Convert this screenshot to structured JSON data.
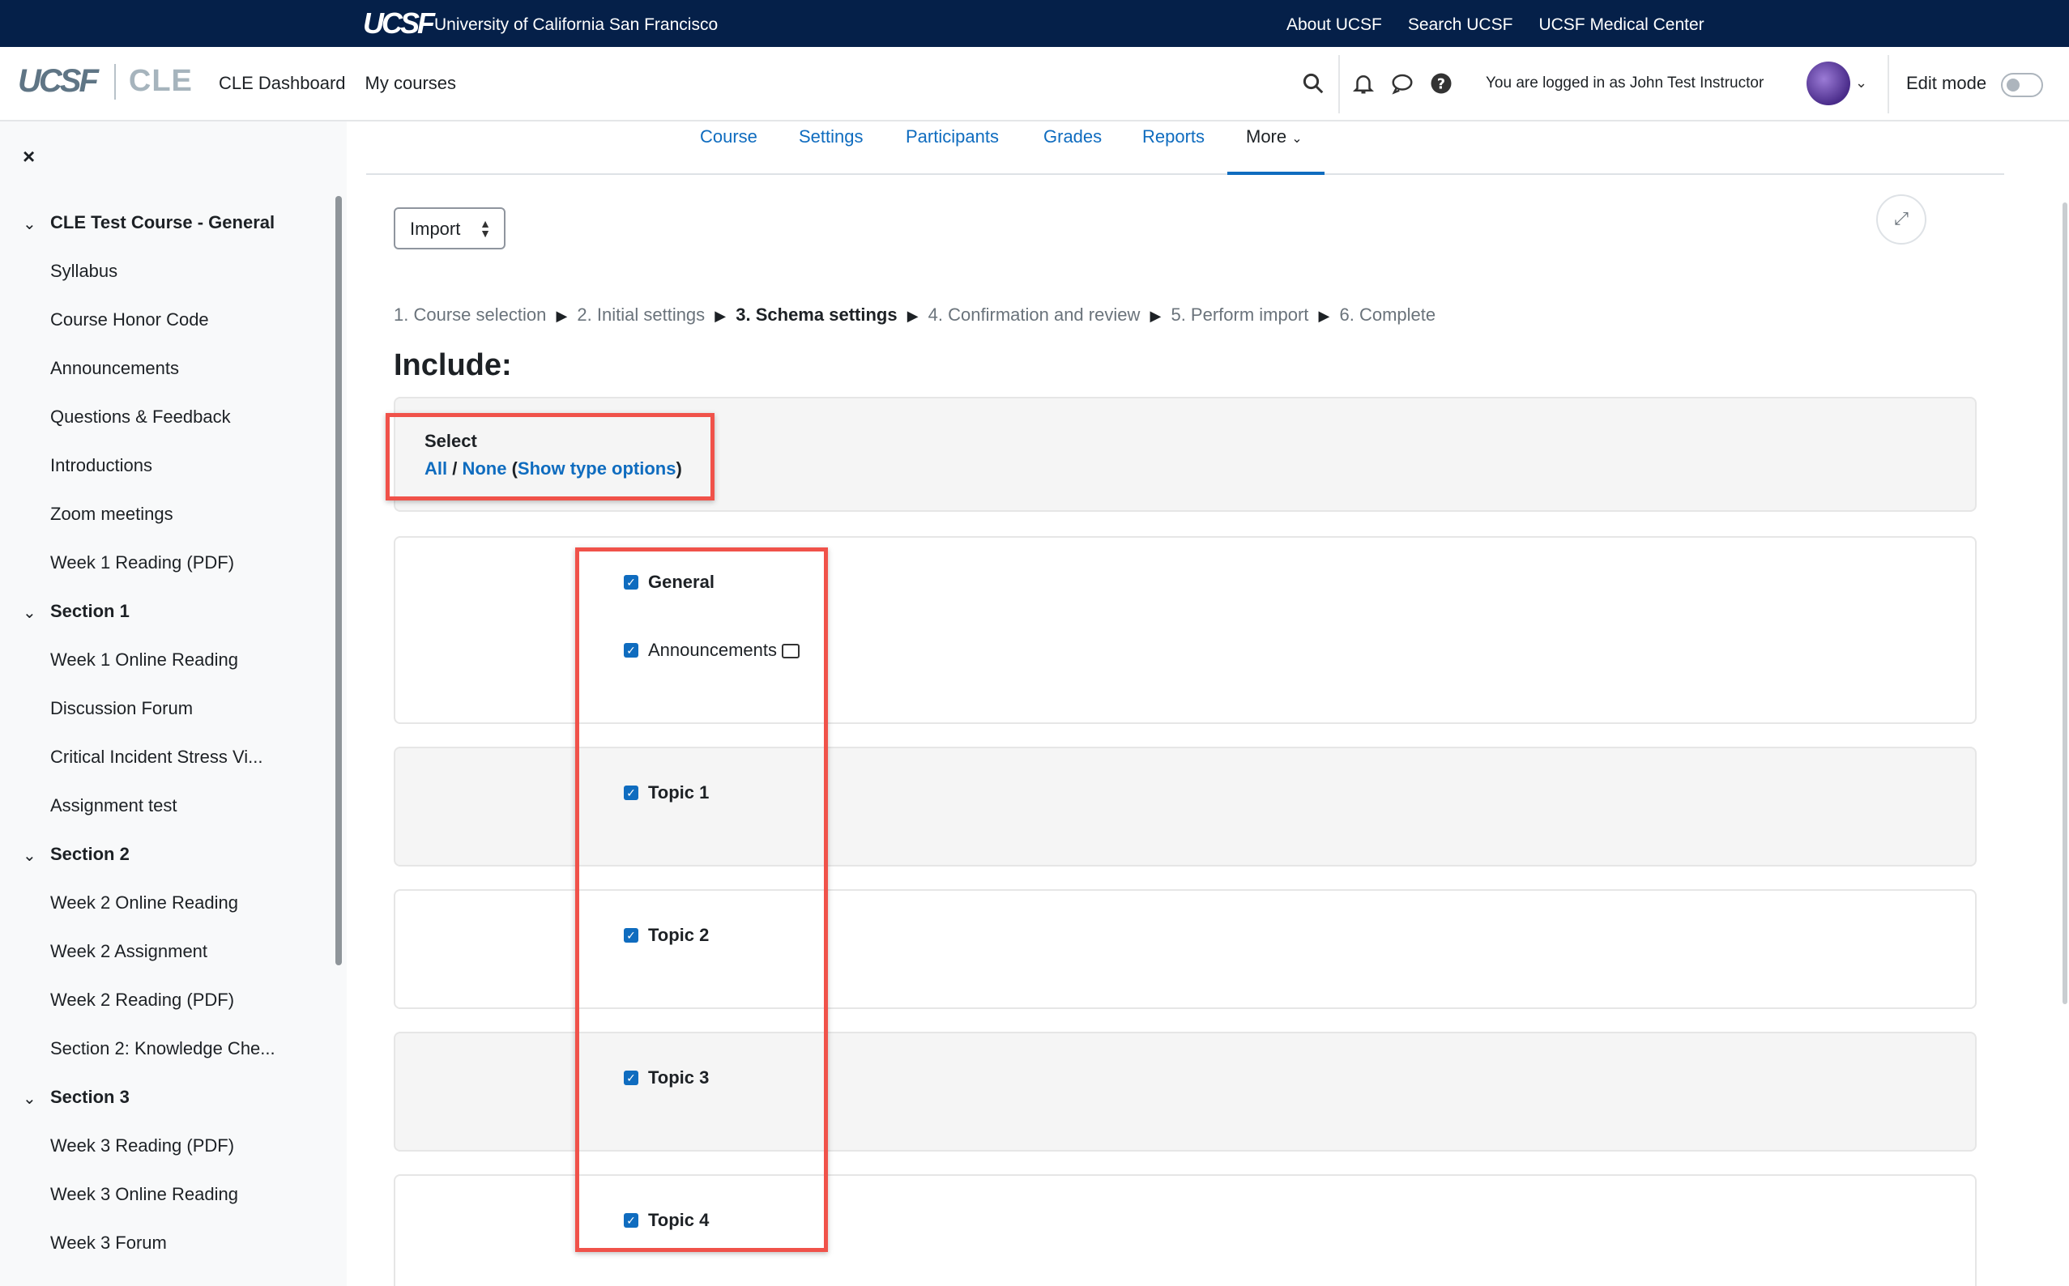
{
  "topbar": {
    "logo": "UCSF",
    "university": "University of California San Francisco",
    "links": [
      "About UCSF",
      "Search UCSF",
      "UCSF Medical Center"
    ]
  },
  "navbar": {
    "logo_ucsf": "UCSF",
    "logo_cle": "CLE",
    "links": [
      "CLE Dashboard",
      "My courses"
    ],
    "logged_in": "You are logged in as John Test Instructor",
    "edit_mode_label": "Edit mode",
    "edit_mode_on": false
  },
  "sidebar": {
    "close_icon": "×",
    "items": [
      {
        "label": "CLE Test Course - General",
        "section": true
      },
      {
        "label": "Syllabus",
        "section": false
      },
      {
        "label": "Course Honor Code",
        "section": false
      },
      {
        "label": "Announcements",
        "section": false
      },
      {
        "label": "Questions & Feedback",
        "section": false
      },
      {
        "label": "Introductions",
        "section": false
      },
      {
        "label": "Zoom meetings",
        "section": false
      },
      {
        "label": "Week 1 Reading (PDF)",
        "section": false
      },
      {
        "label": "Section 1",
        "section": true
      },
      {
        "label": "Week 1 Online Reading",
        "section": false
      },
      {
        "label": "Discussion Forum",
        "section": false
      },
      {
        "label": "Critical Incident Stress Vi...",
        "section": false
      },
      {
        "label": "Assignment test",
        "section": false
      },
      {
        "label": "Section 2",
        "section": true
      },
      {
        "label": "Week 2 Online Reading",
        "section": false
      },
      {
        "label": "Week 2 Assignment",
        "section": false
      },
      {
        "label": "Week 2 Reading (PDF)",
        "section": false
      },
      {
        "label": "Section 2: Knowledge Che...",
        "section": false
      },
      {
        "label": "Section 3",
        "section": true
      },
      {
        "label": "Week 3 Reading (PDF)",
        "section": false
      },
      {
        "label": "Week 3 Online Reading",
        "section": false
      },
      {
        "label": "Week 3 Forum",
        "section": false
      }
    ]
  },
  "secondary_nav": {
    "tabs": [
      "Course",
      "Settings",
      "Participants",
      "Grades",
      "Reports"
    ],
    "more": "More",
    "active": "More"
  },
  "import_select": {
    "value": "Import"
  },
  "steps": {
    "s1": "1. Course selection",
    "s2": "2. Initial settings",
    "s3": "3. Schema settings",
    "s4": "4. Confirmation and review",
    "s5": "5. Perform import",
    "s6": "6. Complete",
    "separator": "▶"
  },
  "include_heading": "Include:",
  "select_box": {
    "label": "Select",
    "all": "All",
    "slash": " / ",
    "none": "None",
    "open_paren": " (",
    "show_type": "Show type options",
    "close_paren": ")"
  },
  "checkboxes": [
    {
      "label": "General",
      "bold": true,
      "checked": true
    },
    {
      "label": "Announcements",
      "bold": false,
      "checked": true,
      "icon": "forum-icon"
    },
    {
      "label": "Topic 1",
      "bold": true,
      "checked": true
    },
    {
      "label": "Topic 2",
      "bold": true,
      "checked": true
    },
    {
      "label": "Topic 3",
      "bold": true,
      "checked": true
    },
    {
      "label": "Topic 4",
      "bold": true,
      "checked": true
    }
  ],
  "colors": {
    "topbar": "#052049",
    "link": "#0f6cbf",
    "highlight": "#f0524a",
    "sidebar_bg": "#f8f9fa"
  }
}
